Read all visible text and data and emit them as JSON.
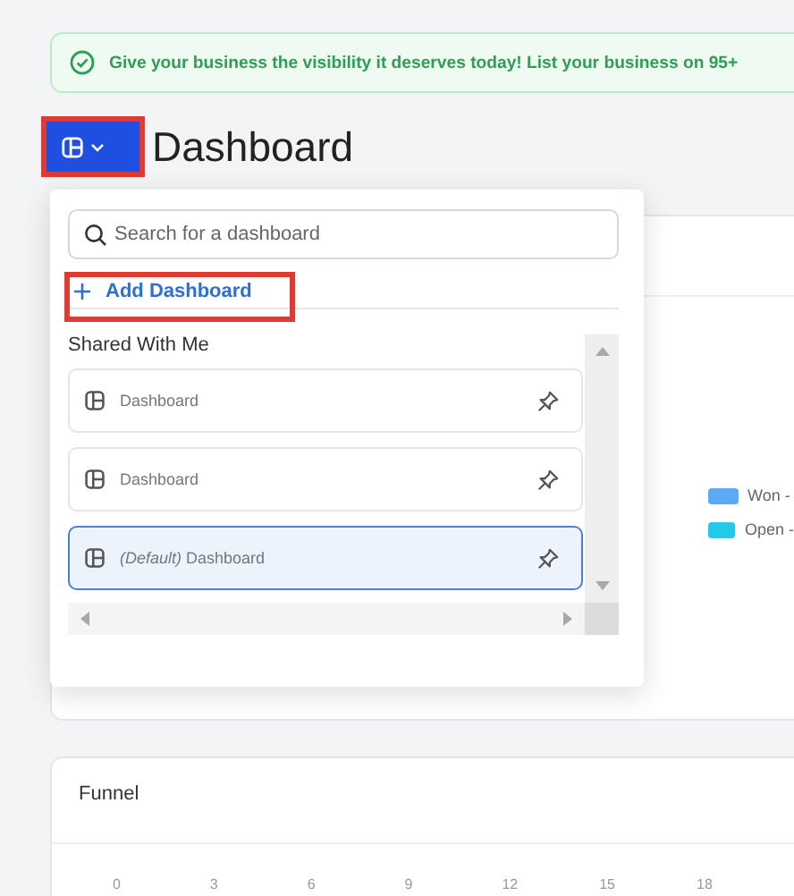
{
  "banner": {
    "text": "Give your business the visibility it deserves today! List your business on 95+"
  },
  "header": {
    "switcher": {
      "highlighted": true
    },
    "title": "Dashboard"
  },
  "dropdown": {
    "search": {
      "placeholder": "Search for a dashboard"
    },
    "add_button": {
      "label": "Add Dashboard",
      "highlighted": true
    },
    "section_title": "Shared With Me",
    "items": [
      {
        "label": "Dashboard",
        "selected": false
      },
      {
        "label": "Dashboard",
        "selected": false
      },
      {
        "label": "*(Default)* Dashboard",
        "selected": true
      }
    ]
  },
  "legend": [
    {
      "label": "Won -",
      "color": "#5aaaf5"
    },
    {
      "label": "Open -",
      "color": "#22c9ea"
    }
  ],
  "funnel": {
    "title": "Funnel",
    "axis_ticks": [
      "0",
      "3",
      "6",
      "9",
      "12",
      "15",
      "18"
    ]
  }
}
